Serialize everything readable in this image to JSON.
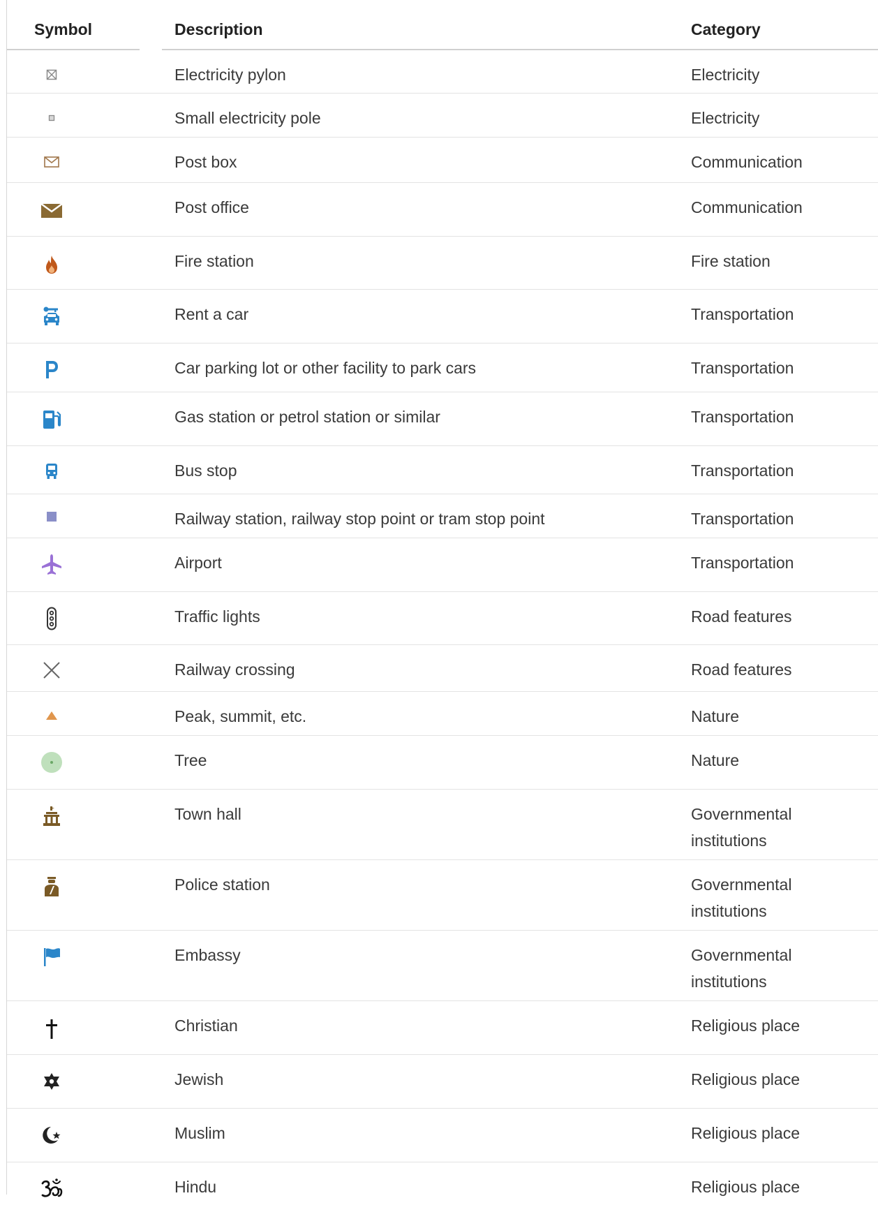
{
  "headers": {
    "symbol": "Symbol",
    "description": "Description",
    "category": "Category"
  },
  "rows": [
    {
      "icon": "electricity-pylon-icon",
      "description": "Electricity pylon",
      "category": "Electricity"
    },
    {
      "icon": "small-electricity-pole-icon",
      "description": "Small electricity pole",
      "category": "Electricity"
    },
    {
      "icon": "post-box-icon",
      "description": "Post box",
      "category": "Communication"
    },
    {
      "icon": "post-office-icon",
      "description": "Post office",
      "category": "Communication"
    },
    {
      "icon": "fire-station-icon",
      "description": "Fire station",
      "category": "Fire station"
    },
    {
      "icon": "rent-a-car-icon",
      "description": "Rent a car",
      "category": "Transportation"
    },
    {
      "icon": "parking-icon",
      "description": "Car parking lot or other facility to park cars",
      "category": "Transportation"
    },
    {
      "icon": "gas-station-icon",
      "description": "Gas station or petrol station or similar",
      "category": "Transportation"
    },
    {
      "icon": "bus-stop-icon",
      "description": "Bus stop",
      "category": "Transportation"
    },
    {
      "icon": "railway-station-icon",
      "description": "Railway station, railway stop point or tram stop point",
      "category": "Transportation"
    },
    {
      "icon": "airport-icon",
      "description": "Airport",
      "category": "Transportation"
    },
    {
      "icon": "traffic-lights-icon",
      "description": "Traffic lights",
      "category": "Road features"
    },
    {
      "icon": "railway-crossing-icon",
      "description": "Railway crossing",
      "category": "Road features"
    },
    {
      "icon": "peak-icon",
      "description": "Peak, summit, etc.",
      "category": "Nature"
    },
    {
      "icon": "tree-icon",
      "description": "Tree",
      "category": "Nature"
    },
    {
      "icon": "town-hall-icon",
      "description": "Town hall",
      "category": "Governmental institutions"
    },
    {
      "icon": "police-station-icon",
      "description": "Police station",
      "category": "Governmental institutions"
    },
    {
      "icon": "embassy-icon",
      "description": "Embassy",
      "category": "Governmental institutions"
    },
    {
      "icon": "christian-cross-icon",
      "description": "Christian",
      "category": "Religious place"
    },
    {
      "icon": "star-of-david-icon",
      "description": "Jewish",
      "category": "Religious place"
    },
    {
      "icon": "crescent-star-icon",
      "description": "Muslim",
      "category": "Religious place"
    },
    {
      "icon": "om-icon",
      "description": "Hindu",
      "category": "Religious place"
    }
  ]
}
